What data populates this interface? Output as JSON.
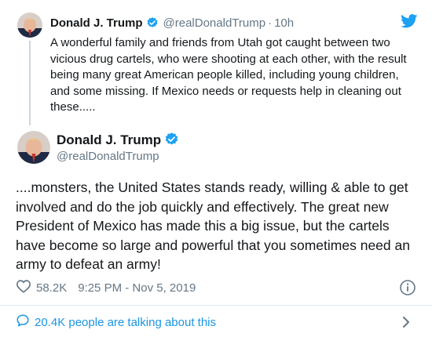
{
  "colors": {
    "accent": "#1da1f2",
    "link": "#1b95e0",
    "secondary_text": "#657786",
    "divider": "#e1e8ed"
  },
  "parent_tweet": {
    "author_name": "Donald J. Trump",
    "handle": "@realDonaldTrump",
    "separator": "·",
    "time": "10h",
    "text": "A wonderful family and friends from Utah got caught between two vicious drug cartels, who were shooting at each other, with the result being many great American people killed, including young children, and some missing. If Mexico needs or requests help in cleaning out these....."
  },
  "main_tweet": {
    "author_name": "Donald J. Trump",
    "handle": "@realDonaldTrump",
    "text": "....monsters, the United States stands ready, willing & able to get involved and do the job quickly and effectively. The great new President of Mexico has made this a big issue, but the cartels have become so large and powerful that you sometimes need an army to defeat an army!",
    "likes": "58.2K",
    "timestamp": "9:25 PM - Nov 5, 2019"
  },
  "footer": {
    "talking_text": "20.4K people are talking about this"
  },
  "icons": {
    "twitter_bird": "twitter-bird-icon",
    "verified": "verified-badge-icon",
    "heart": "heart-icon",
    "info": "info-icon",
    "comment": "comment-icon",
    "chevron": "chevron-right-icon"
  }
}
